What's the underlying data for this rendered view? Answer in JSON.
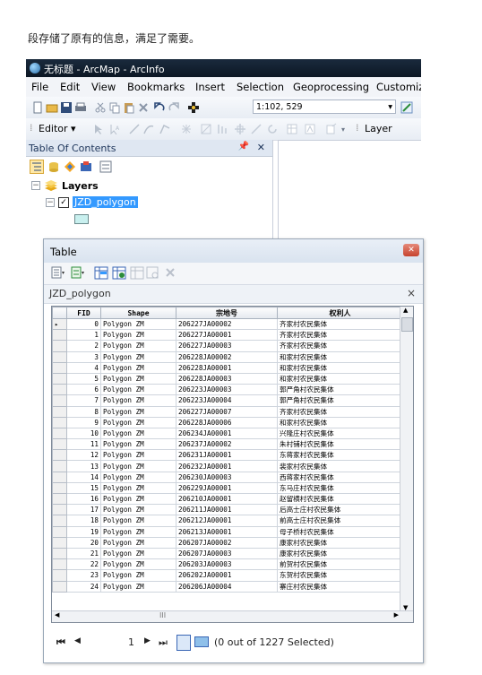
{
  "caption": "段存储了原有的信息，满足了需要。",
  "window": {
    "title": "无标题 - ArcMap - ArcInfo"
  },
  "menu": [
    "File",
    "Edit",
    "View",
    "Bookmarks",
    "Insert",
    "Selection",
    "Geoprocessing",
    "Customiz"
  ],
  "toolbar": {
    "scale": "1:102, 529",
    "editor_label": "Editor ▾",
    "layer_label": "Layer"
  },
  "toc": {
    "title": "Table Of Contents",
    "root_label": "Layers",
    "layer_label": "JZD_polygon"
  },
  "table": {
    "title": "Table",
    "tab_label": "JZD_polygon",
    "columns": [
      "FID",
      "Shape",
      "宗地号",
      "权利人"
    ],
    "rows": [
      [
        "0",
        "Polygon ZM",
        "206227JA00002",
        "齐家村农民集体"
      ],
      [
        "1",
        "Polygon ZM",
        "206227JA00001",
        "齐家村农民集体"
      ],
      [
        "2",
        "Polygon ZM",
        "206227JA00003",
        "齐家村农民集体"
      ],
      [
        "3",
        "Polygon ZM",
        "206228JA00002",
        "和家村农民集体"
      ],
      [
        "4",
        "Polygon ZM",
        "206228JA00001",
        "和家村农民集体"
      ],
      [
        "5",
        "Polygon ZM",
        "206228JA00003",
        "和家村农民集体"
      ],
      [
        "6",
        "Polygon ZM",
        "206223JA00003",
        "郭严角村农民集体"
      ],
      [
        "7",
        "Polygon ZM",
        "206223JA00004",
        "郭严角村农民集体"
      ],
      [
        "8",
        "Polygon ZM",
        "206227JA00007",
        "齐家村农民集体"
      ],
      [
        "9",
        "Polygon ZM",
        "206228JA00006",
        "和家村农民集体"
      ],
      [
        "10",
        "Polygon ZM",
        "206234JA00001",
        "兴隆庄村农民集体"
      ],
      [
        "11",
        "Polygon ZM",
        "206237JA00002",
        "朱村铺村农民集体"
      ],
      [
        "12",
        "Polygon ZM",
        "206231JA00001",
        "东蒋家村农民集体"
      ],
      [
        "13",
        "Polygon ZM",
        "206232JA00001",
        "裴家村农民集体"
      ],
      [
        "14",
        "Polygon ZM",
        "206230JA00003",
        "西蒋家村农民集体"
      ],
      [
        "15",
        "Polygon ZM",
        "206229JA00001",
        "东马庄村农民集体"
      ],
      [
        "16",
        "Polygon ZM",
        "206210JA00001",
        "赵留横村农民集体"
      ],
      [
        "17",
        "Polygon ZM",
        "206211JA00001",
        "后高士庄村农民集体"
      ],
      [
        "18",
        "Polygon ZM",
        "206212JA00001",
        "前高士庄村农民集体"
      ],
      [
        "19",
        "Polygon ZM",
        "206213JA00001",
        "母子桥村农民集体"
      ],
      [
        "20",
        "Polygon ZM",
        "206207JA00002",
        "康家村农民集体"
      ],
      [
        "21",
        "Polygon ZM",
        "206207JA00003",
        "康家村农民集体"
      ],
      [
        "22",
        "Polygon ZM",
        "206203JA00003",
        "前贺村农民集体"
      ],
      [
        "23",
        "Polygon ZM",
        "206202JA00001",
        "东贺村农民集体"
      ],
      [
        "24",
        "Polygon ZM",
        "206206JA00004",
        "寨庄村农民集体"
      ]
    ],
    "hscroll_mark": "III",
    "nav": {
      "record": "1",
      "status": "(0 out of 1227 Selected)"
    }
  },
  "colors": {
    "titlebar": "#0c1724",
    "selection": "#3399ff",
    "toc_header": "#dfe7f2"
  }
}
